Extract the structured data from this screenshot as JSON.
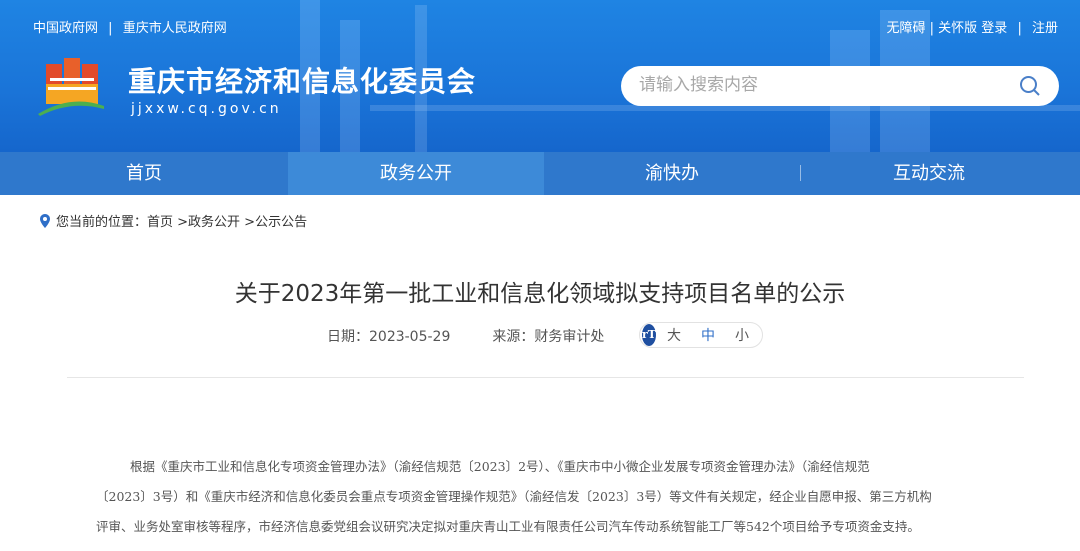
{
  "header": {
    "top_links": [
      "中国政府网",
      "|",
      "重庆市人民政府网"
    ],
    "right_links": [
      "无障碍",
      "|",
      "关怀版",
      "登录",
      "|",
      "注册"
    ],
    "site_name": "重庆市经济和信息化委员会",
    "domain": "jjxxw.cq.gov.cn",
    "search_placeholder": "请输入搜索内容"
  },
  "nav": {
    "items": [
      "首页",
      "政务公开",
      "渝快办",
      "互动交流"
    ],
    "active": "政务公开"
  },
  "breadcrumb": {
    "label": "您当前的位置：",
    "path": "首页 >政务公开 >公示公告"
  },
  "article": {
    "title": "关于2023年第一批工业和信息化领域拟支持项目名单的公示",
    "date": "日期：2023-05-29",
    "source": "来源：财务审计处",
    "font_sizes": [
      "大",
      "中",
      "小"
    ],
    "font_icon": "rT",
    "body_lines": [
      "根据《重庆市工业和信息化专项资金管理办法》（渝经信规范〔2023〕2号）、《重庆市中小微企业发展专项资金管理办法》（渝经信规范",
      "〔2023〕3号）和《重庆市经济和信息化委员会重点专项资金管理操作规范》（渝经信发〔2023〕3号）等文件有关规定，经企业自愿申报、第三方机构",
      "评审、业务处室审核等程序，市经济信息委党组会议研究决定拟对重庆青山工业有限责任公司汽车传动系统智能工厂等542个项目给予专项资金支持。"
    ]
  },
  "colors": {
    "header_blue": "#1a74d8",
    "nav_blue": "#2f78cc",
    "nav_active": "#3d8ad8"
  }
}
